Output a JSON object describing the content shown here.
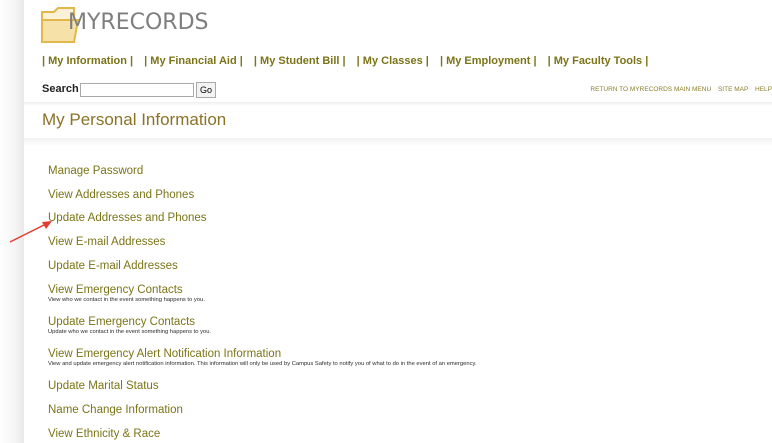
{
  "app": {
    "logo_text": "MYRECORDS"
  },
  "nav": {
    "items": [
      "| My Information |",
      "| My Financial Aid |",
      "| My Student Bill |",
      "| My Classes |",
      "| My Employment |",
      "| My Faculty Tools |"
    ]
  },
  "search": {
    "label": "Search",
    "value": "",
    "go_label": "Go"
  },
  "top_links": [
    "RETURN TO MYRECORDS MAIN MENU",
    "SITE MAP",
    "HELP"
  ],
  "page": {
    "title": "My Personal Information"
  },
  "links": [
    {
      "label": "Manage Password"
    },
    {
      "label": "View Addresses and Phones"
    },
    {
      "label": "Update Addresses and Phones"
    },
    {
      "label": "View E-mail Addresses"
    },
    {
      "label": "Update E-mail Addresses"
    },
    {
      "label": "View Emergency Contacts",
      "desc": "View who we contact in the event something happens to you."
    },
    {
      "label": "Update Emergency Contacts",
      "desc": "Update who we contact in the event something happens to you."
    },
    {
      "label": "View Emergency Alert Notification Information",
      "desc": "View and update emergency alert notification information. This information will only be used by Campus Safety to notify you of what to do in the event of an emergency."
    },
    {
      "label": "Update Marital Status"
    },
    {
      "label": "Name Change Information"
    },
    {
      "label": "View Ethnicity & Race"
    }
  ],
  "colors": {
    "link": "#7b7418",
    "title": "#8a7226",
    "logo_gold": "#e2b84a",
    "annotation_arrow": "#e53b30"
  }
}
